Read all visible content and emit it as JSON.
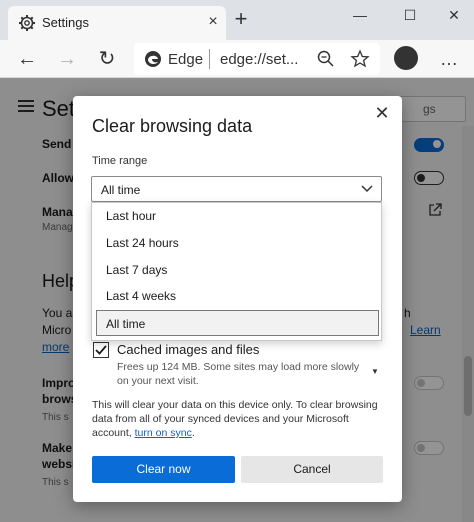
{
  "tab": {
    "title": "Settings",
    "close_icon": "×",
    "new_tab_icon": "+"
  },
  "window": {
    "minimize": "—",
    "maximize": "☐",
    "close": "✕"
  },
  "toolbar": {
    "back": "←",
    "forward": "→",
    "refresh": "↻",
    "address_brand": "Edge",
    "address_url": "edge://set...",
    "zoom_icon": "🔍",
    "favorite_icon": "☆",
    "more": "…"
  },
  "settings_page": {
    "title": "Set",
    "search_placeholder": "gs",
    "rows": [
      {
        "text": "Send"
      },
      {
        "text": "Allow"
      },
      {
        "text": "Mana"
      },
      {
        "text": "Manag"
      },
      {
        "text": "Help"
      },
      {
        "text": "You a"
      },
      {
        "text": "Micro"
      },
      {
        "text": "more"
      },
      {
        "text": "Impro"
      },
      {
        "text": "brows"
      },
      {
        "text": "This s"
      },
      {
        "text": "Make"
      },
      {
        "text": "websi"
      },
      {
        "text": "This s"
      }
    ],
    "right_fragments": {
      "h": "h",
      "learn": "Learn"
    }
  },
  "dialog": {
    "title": "Clear browsing data",
    "close_icon": "✕",
    "time_range_label": "Time range",
    "time_range_value": "All time",
    "chevron": "⌄",
    "options": [
      "Last hour",
      "Last 24 hours",
      "Last 7 days",
      "Last 4 weeks",
      "All time"
    ],
    "selected_option": "All time",
    "checkbox": {
      "checked": true,
      "label": "Cached images and files",
      "desc": "Frees up 124 MB. Some sites may load more slowly on your next visit."
    },
    "info_text": "This will clear your data on this device only. To clear browsing data from all of your synced devices and your Microsoft account, ",
    "info_link": "turn on sync",
    "info_end": ".",
    "clear_button": "Clear now",
    "cancel_button": "Cancel"
  }
}
